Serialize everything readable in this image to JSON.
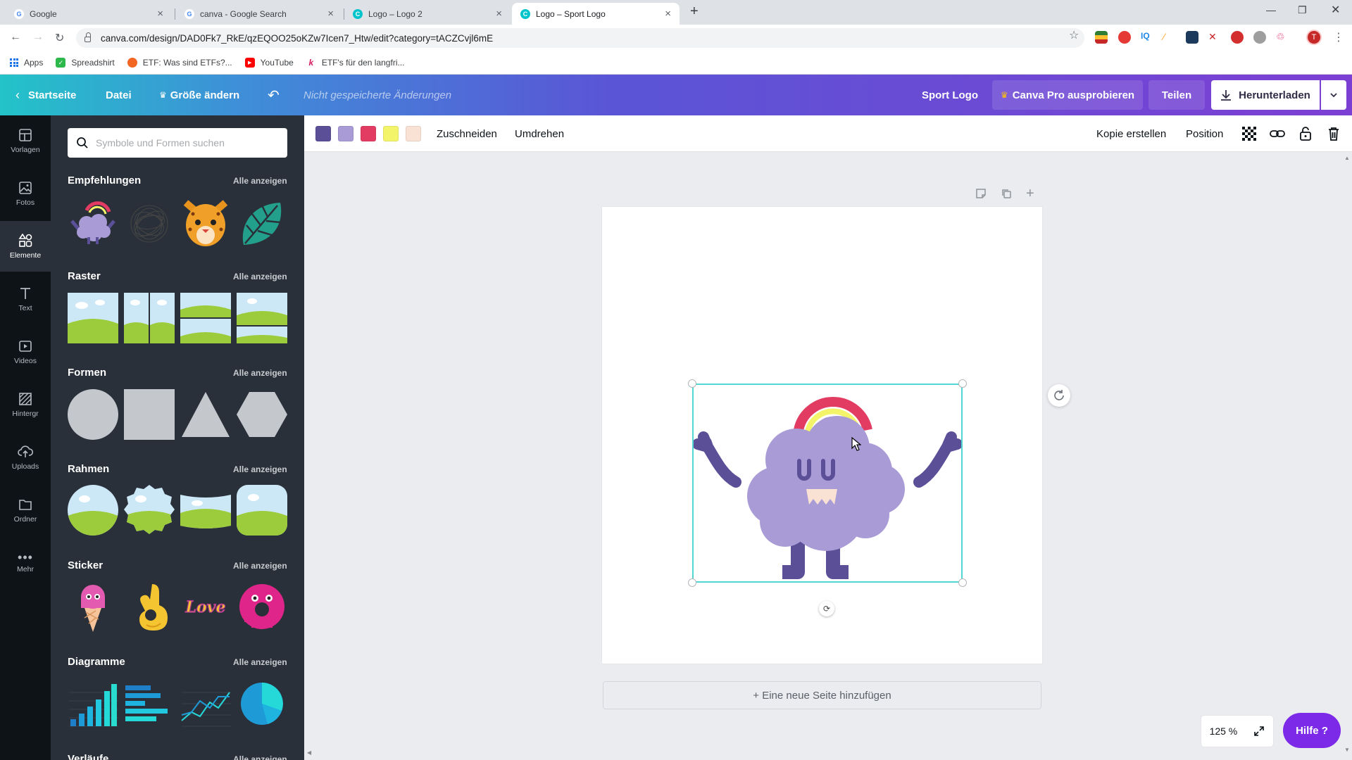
{
  "browser": {
    "tabs": [
      {
        "title": "Google",
        "favicon": "G"
      },
      {
        "title": "canva - Google Search",
        "favicon": "G"
      },
      {
        "title": "Logo – Logo 2",
        "favicon": "C"
      },
      {
        "title": "Logo – Sport Logo",
        "favicon": "C"
      }
    ],
    "url": "canva.com/design/DAD0Fk7_RkE/qzEQOO25oKZw7Icen7_Htw/edit?category=tACZCvjl6mE",
    "profile_initial": "T",
    "bookmarks": [
      {
        "label": "Apps"
      },
      {
        "label": "Spreadshirt",
        "color": "#2db84c"
      },
      {
        "label": "ETF: Was sind ETFs?...",
        "color": "#f26522"
      },
      {
        "label": "YouTube",
        "color": "#ff0000"
      },
      {
        "label": "ETF's für den langfri...",
        "color": "#d81b60"
      }
    ]
  },
  "header": {
    "home": "Startseite",
    "file": "Datei",
    "resize": "Größe ändern",
    "unsaved": "Nicht gespeicherte Änderungen",
    "design_name": "Sport Logo",
    "pro": "Canva Pro ausprobieren",
    "share": "Teilen",
    "download": "Herunterladen"
  },
  "rail": [
    {
      "label": "Vorlagen",
      "icon": "template-icon"
    },
    {
      "label": "Fotos",
      "icon": "photo-icon"
    },
    {
      "label": "Elemente",
      "icon": "elements-icon",
      "active": true
    },
    {
      "label": "Text",
      "icon": "text-icon"
    },
    {
      "label": "Videos",
      "icon": "video-icon"
    },
    {
      "label": "Hintergr",
      "icon": "background-icon"
    },
    {
      "label": "Uploads",
      "icon": "upload-icon"
    },
    {
      "label": "Ordner",
      "icon": "folder-icon"
    },
    {
      "label": "Mehr",
      "icon": "more-icon"
    }
  ],
  "panel": {
    "search_placeholder": "Symbole und Formen suchen",
    "see_all": "Alle anzeigen",
    "sections": [
      {
        "title": "Empfehlungen"
      },
      {
        "title": "Raster"
      },
      {
        "title": "Formen"
      },
      {
        "title": "Rahmen"
      },
      {
        "title": "Sticker"
      },
      {
        "title": "Diagramme"
      },
      {
        "title": "Verläufe"
      }
    ]
  },
  "toolbar": {
    "colors": [
      "#5b4f98",
      "#a99bd6",
      "#e23c63",
      "#f4f46a",
      "#f9e2d3"
    ],
    "crop": "Zuschneiden",
    "flip": "Umdrehen",
    "copy": "Kopie erstellen",
    "position": "Position"
  },
  "canvas": {
    "add_page": "+ Eine neue Seite hinzufügen",
    "zoom": "125 %",
    "help": "Hilfe ?"
  }
}
